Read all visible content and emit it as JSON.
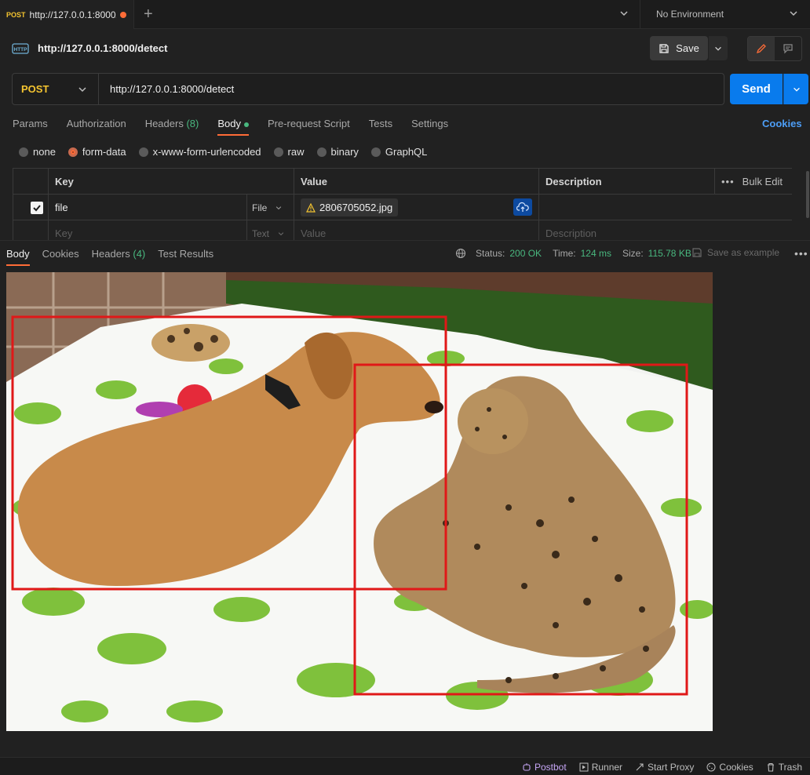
{
  "tab": {
    "method": "POST",
    "url": "http://127.0.0.1:8000/detect"
  },
  "environment": "No Environment",
  "request": {
    "title": "http://127.0.0.1:8000/detect",
    "save_label": "Save",
    "method": "POST",
    "url": "http://127.0.0.1:8000/detect",
    "send_label": "Send"
  },
  "request_tabs": [
    {
      "label": "Params"
    },
    {
      "label": "Authorization"
    },
    {
      "label": "Headers",
      "count": "(8)"
    },
    {
      "label": "Body"
    },
    {
      "label": "Pre-request Script"
    },
    {
      "label": "Tests"
    },
    {
      "label": "Settings"
    }
  ],
  "cookies_link": "Cookies",
  "body_types": [
    "none",
    "form-data",
    "x-www-form-urlencoded",
    "raw",
    "binary",
    "GraphQL"
  ],
  "body_type_selected": "form-data",
  "params_table": {
    "headers": {
      "key": "Key",
      "value": "Value",
      "description": "Description",
      "bulk_edit": "Bulk Edit"
    },
    "row": {
      "key": "file",
      "type": "File",
      "value": "2806705052.jpg"
    },
    "placeholder": {
      "key": "Key",
      "type": "Text",
      "value": "Value",
      "description": "Description"
    }
  },
  "response": {
    "tabs": [
      {
        "label": "Body"
      },
      {
        "label": "Cookies"
      },
      {
        "label": "Headers",
        "count": "(4)"
      },
      {
        "label": "Test Results"
      }
    ],
    "status_label": "Status:",
    "status_value": "200 OK",
    "time_label": "Time:",
    "time_value": "124 ms",
    "size_label": "Size:",
    "size_value": "115.78 KB",
    "save_example": "Save as example"
  },
  "status_bar": {
    "postbot": "Postbot",
    "runner": "Runner",
    "start_proxy": "Start Proxy",
    "cookies": "Cookies",
    "trash": "Trash"
  },
  "colors": {
    "accent": "#ff6c37",
    "send": "#097bed",
    "method": "#f4c430",
    "success": "#49b87f",
    "bbox": "#e01818"
  }
}
